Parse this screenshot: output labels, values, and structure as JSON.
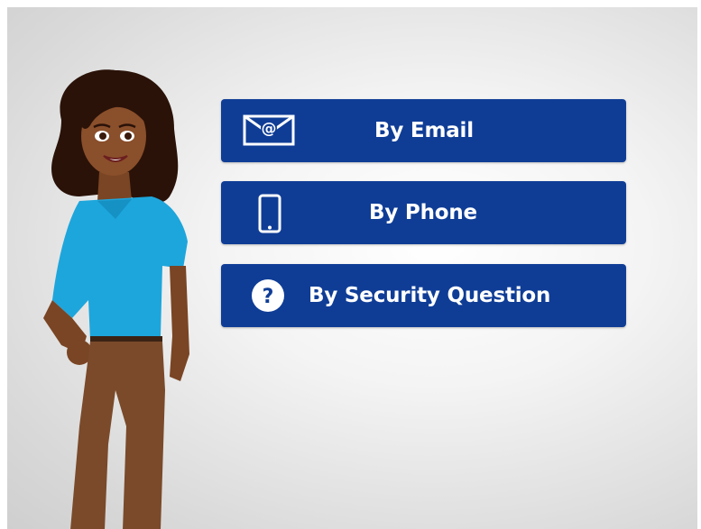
{
  "options": [
    {
      "label": "By Email",
      "icon": "envelope-at-icon"
    },
    {
      "label": "By Phone",
      "icon": "smartphone-icon"
    },
    {
      "label": "By Security Question",
      "icon": "question-circle-icon"
    }
  ],
  "colors": {
    "button_bg": "#0f3d96",
    "button_text": "#ffffff",
    "background": "#e6e6e6"
  },
  "character": {
    "icon": "presenter-woman-illustration"
  }
}
